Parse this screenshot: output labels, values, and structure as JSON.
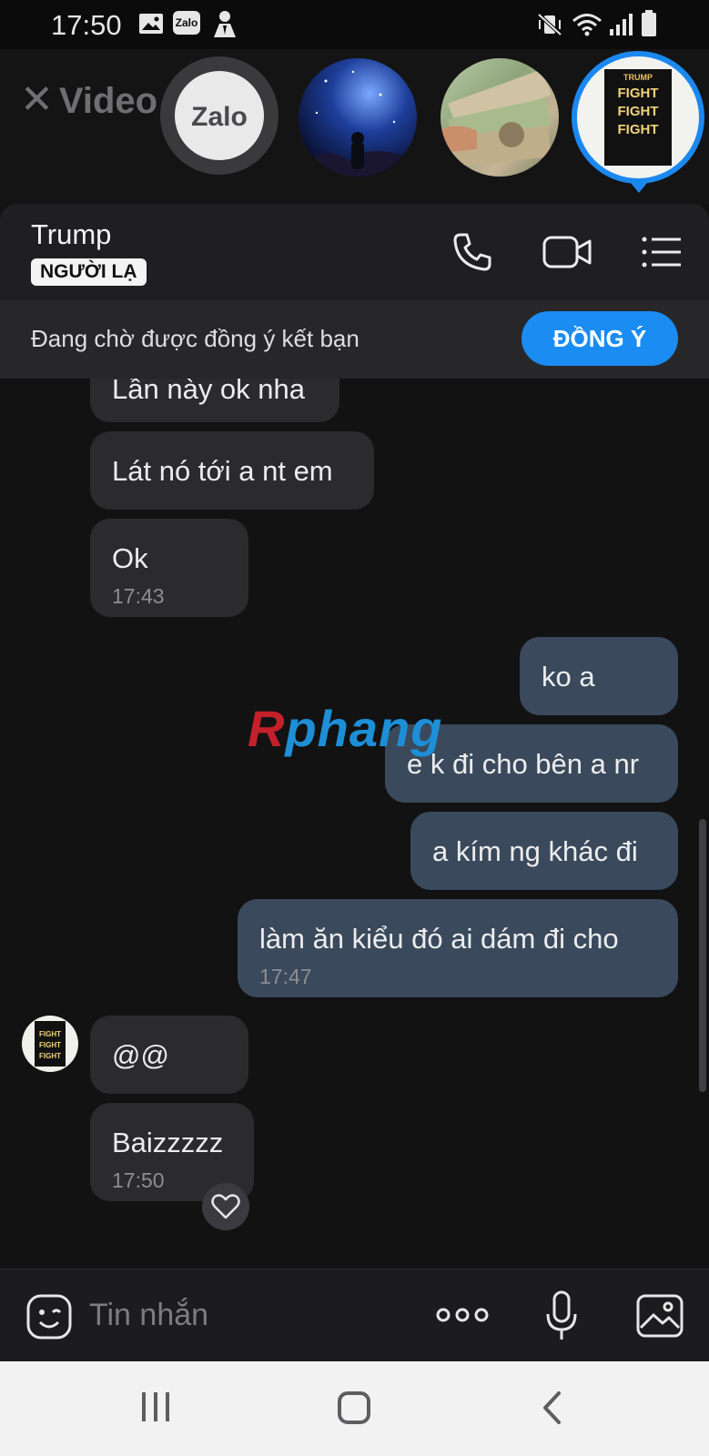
{
  "status_bar": {
    "time": "17:50",
    "icons": [
      "gallery-icon",
      "zalo-app-icon",
      "user-app-icon",
      "mute-vibrate-icon",
      "wifi-icon",
      "signal-icon",
      "battery-icon"
    ],
    "zalo_badge": "Zalo"
  },
  "top_strip": {
    "close_label": "Video",
    "chat_heads": [
      {
        "name": "Zalo",
        "label": "Zalo"
      },
      {
        "name": "starry-sky"
      },
      {
        "name": "money"
      },
      {
        "name": "Trump",
        "active": true,
        "poster_title": "TRUMP",
        "poster_words": [
          "FIGHT",
          "FIGHT",
          "FIGHT"
        ]
      }
    ],
    "accent": "#1b88f0"
  },
  "header": {
    "contact_name": "Trump",
    "badge": "NGƯỜI LẠ"
  },
  "friend_request": {
    "text": "Đang chờ được đồng ý kết bạn",
    "accept_label": "ĐỒNG Ý"
  },
  "messages": [
    {
      "side": "in",
      "text": "Lần này ok nha"
    },
    {
      "side": "in",
      "text": "Lát nó tới a nt em"
    },
    {
      "side": "in",
      "text": "Ok",
      "time": "17:43"
    },
    {
      "side": "out",
      "text": "ko a"
    },
    {
      "side": "out",
      "text": "e k đi cho bên a nr"
    },
    {
      "side": "out",
      "text": "a kím ng khác đi"
    },
    {
      "side": "out",
      "text": "làm ăn kiểu đó ai dám đi cho",
      "time": "17:47"
    },
    {
      "side": "in",
      "text": "@@"
    },
    {
      "side": "in",
      "text": "Baizzzzz",
      "time": "17:50"
    }
  ],
  "watermark": {
    "part1": "R",
    "part2": "phang"
  },
  "input_bar": {
    "placeholder": "Tin nhắn"
  },
  "colors": {
    "background": "#121213",
    "incoming_bubble": "#2b2b2e",
    "outgoing_bubble": "#3a4a5c",
    "accept_button": "#1a8cf2"
  }
}
